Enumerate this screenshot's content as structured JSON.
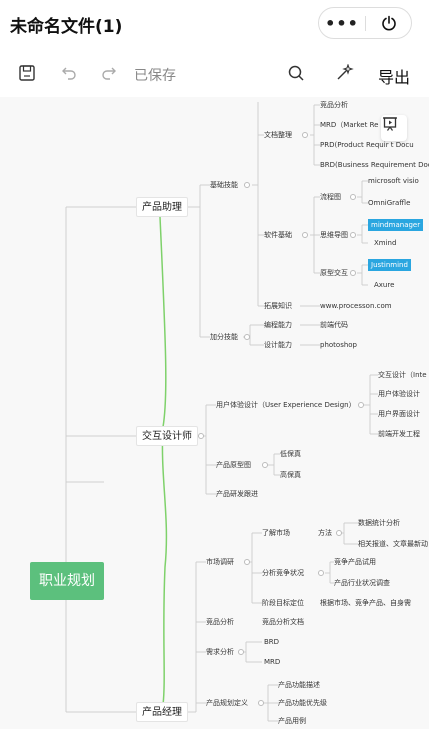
{
  "header": {
    "title": "未命名文件(1)",
    "more_label": "•••"
  },
  "toolbar": {
    "saved_label": "已保存",
    "export_label": "导出"
  },
  "mindmap": {
    "root": "职业规划",
    "branches": {
      "assistant": "产品助理",
      "designer": "交互设计师",
      "manager": "产品经理"
    },
    "nodes": {
      "basic_skills": "基础技能",
      "doc_org": "文档整理",
      "competitor": "竞品分析",
      "mrd": "MRD（Market Re Docu",
      "prd": "PRD(Product Requir  t Docu",
      "brd": "BRD(Business Requirement Docu",
      "software_basics": "软件基础",
      "flowchart": "流程图",
      "visio": "microsoft visio",
      "omnigraffle": "OmniGraffle",
      "mindmap_node": "思维导图",
      "mindmanager": "mindmanager",
      "xmind": "Xmind",
      "prototype": "原型交互",
      "justinmind": "Justinmind",
      "axure": "Axure",
      "expand": "拓展知识",
      "processon": "www.processon.com",
      "bonus": "加分技能",
      "coding": "编程能力",
      "frontend": "前端代码",
      "design_ability": "设计能力",
      "photoshop": "photoshop",
      "ux": "用户体验设计（User Experience Design）",
      "ixd": "交互设计（Inte",
      "ux_design": "用户体验设计",
      "ui_design": "用户界面设计",
      "fe_eng": "前端开发工程",
      "proto_map": "产品原型图",
      "low_fi": "低保真",
      "high_fi": "高保真",
      "dev_track": "产品研发跟进",
      "market_research": "市场调研",
      "understand_market": "了解市场",
      "method": "方法",
      "data_stats": "数据统计分析",
      "news": "相关报道、文章最新动",
      "competition": "分析竞争状况",
      "trial": "竞争产品试用",
      "industry": "产品行业状况调查",
      "stage_goal": "阶段目标定位",
      "by_market": "根据市场、竞争产品、自身需",
      "comp_analysis": "竞品分析",
      "comp_doc": "竞品分析文档",
      "req_analysis": "需求分析",
      "brd2": "BRD",
      "mrd2": "MRD",
      "product_plan": "产品规划定义",
      "feature_desc": "产品功能描述",
      "feature_priority": "产品功能优先级",
      "use_case": "产品用例"
    }
  },
  "colors": {
    "root": "#5cc07d",
    "highlight": "#2aa6e0",
    "branch_line": "#7ed16a",
    "line": "#cfcfcf"
  }
}
